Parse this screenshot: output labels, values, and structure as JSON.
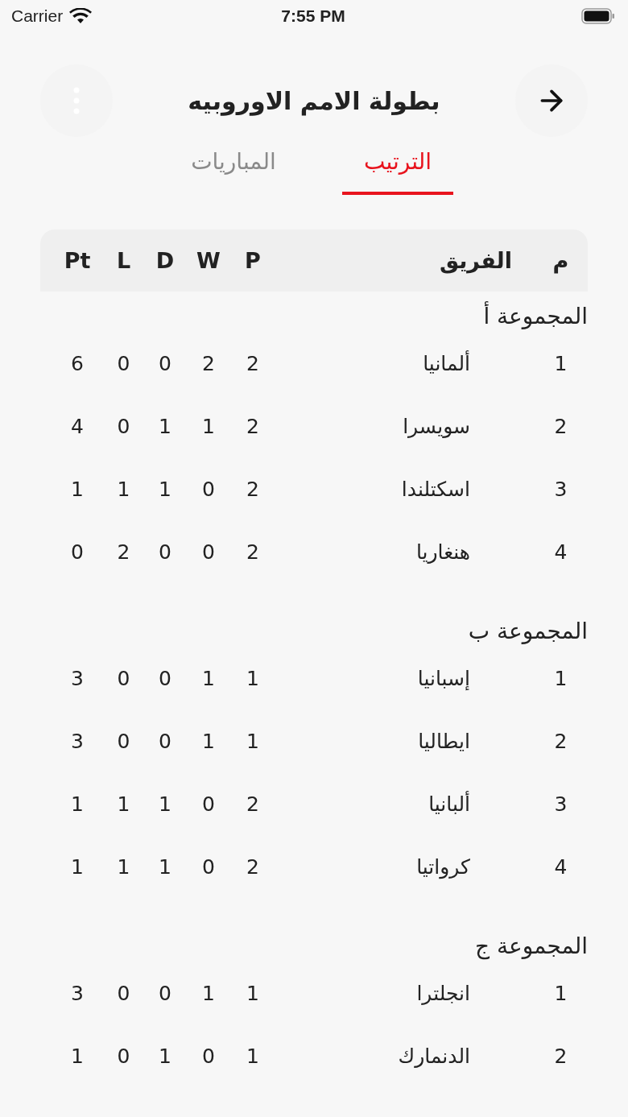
{
  "status_bar": {
    "carrier": "Carrier",
    "time": "7:55 PM"
  },
  "header": {
    "title": "بطولة الامم الاوروبيه"
  },
  "tabs": [
    {
      "label": "الترتيب",
      "selected": true
    },
    {
      "label": "المباريات",
      "selected": false
    }
  ],
  "table": {
    "columns": [
      "م",
      "الفريق",
      "P",
      "W",
      "D",
      "L",
      "Pt"
    ],
    "groups": [
      {
        "title": "المجموعة أ",
        "rows": [
          [
            "1",
            "ألمانيا",
            "2",
            "2",
            "0",
            "0",
            "6"
          ],
          [
            "2",
            "سويسرا",
            "2",
            "1",
            "1",
            "0",
            "4"
          ],
          [
            "3",
            "اسكتلندا",
            "2",
            "0",
            "1",
            "1",
            "1"
          ],
          [
            "4",
            "هنغاريا",
            "2",
            "0",
            "0",
            "2",
            "0"
          ]
        ]
      },
      {
        "title": "المجموعة ب",
        "rows": [
          [
            "1",
            "إسبانيا",
            "1",
            "1",
            "0",
            "0",
            "3"
          ],
          [
            "2",
            "ايطاليا",
            "1",
            "1",
            "0",
            "0",
            "3"
          ],
          [
            "3",
            "ألبانيا",
            "2",
            "0",
            "1",
            "1",
            "1"
          ],
          [
            "4",
            "كرواتيا",
            "2",
            "0",
            "1",
            "1",
            "1"
          ]
        ]
      },
      {
        "title": "المجموعة ج",
        "rows": [
          [
            "1",
            "انجلترا",
            "1",
            "1",
            "0",
            "0",
            "3"
          ],
          [
            "2",
            "الدنمارك",
            "1",
            "0",
            "1",
            "0",
            "1"
          ]
        ]
      }
    ]
  }
}
